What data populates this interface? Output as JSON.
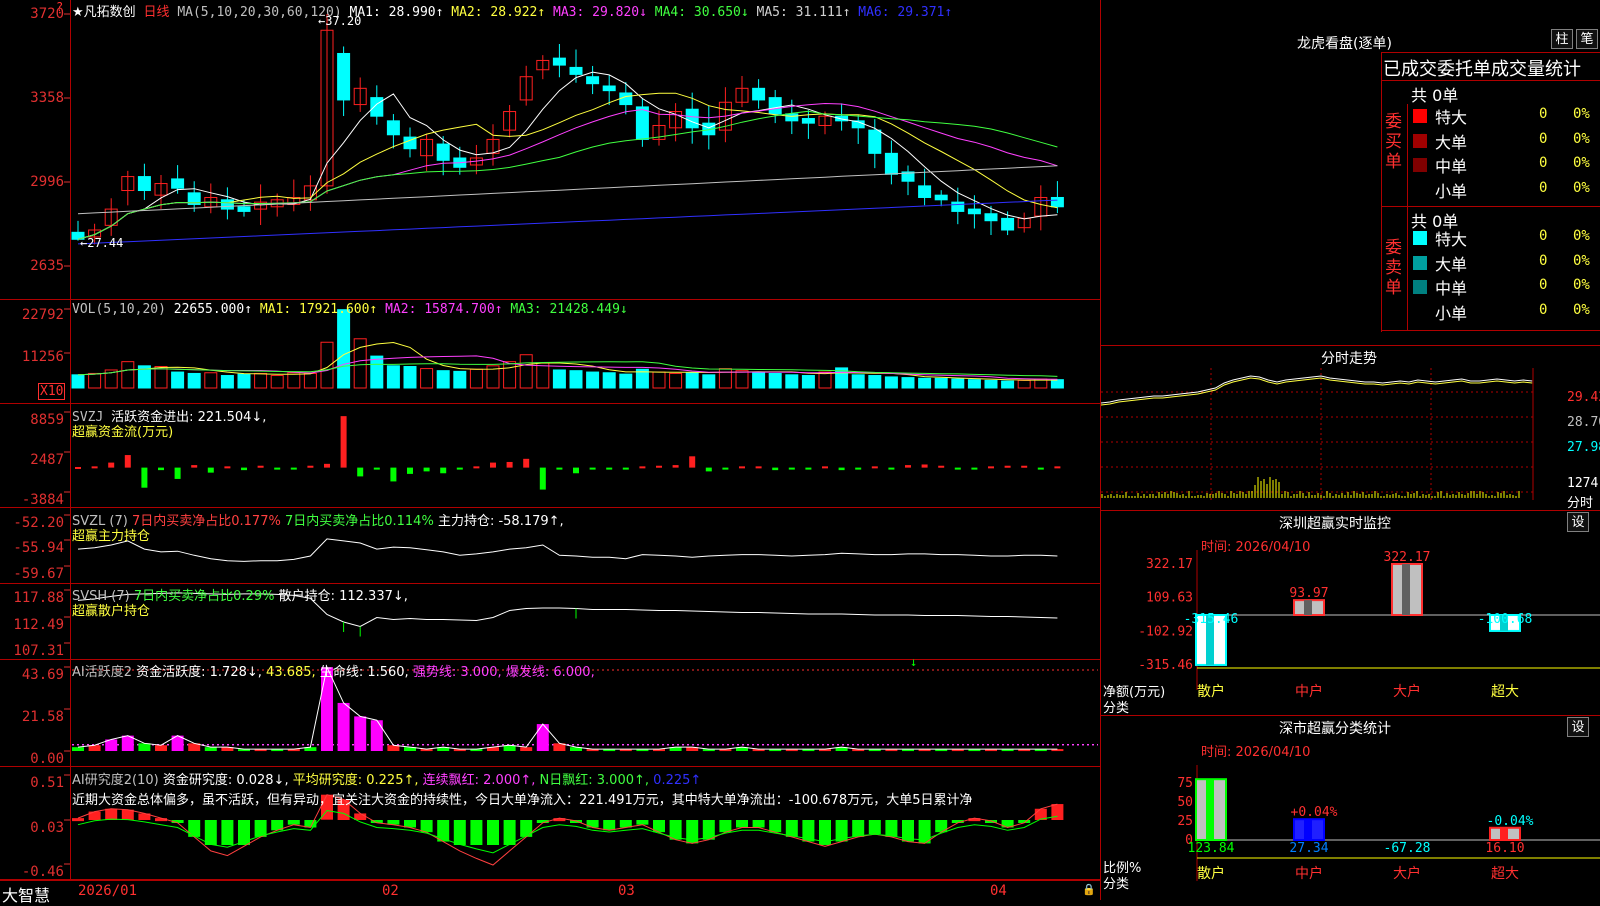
{
  "colors": {
    "up": "#ff2020",
    "down": "#00ffff",
    "ma1": "#ffffff",
    "ma2": "#ffff40",
    "ma3": "#ff40ff",
    "ma4": "#40ff40",
    "ma5": "#c0c0c0",
    "ma6": "#3030ff",
    "grid": "#b00000",
    "accent": "#ffff00"
  },
  "main": {
    "corner": "?",
    "title": "★凡拓数创",
    "period": "日线",
    "ma_label": "MA(5,10,20,30,60,120)",
    "ma1": "MA1: 28.990↑",
    "ma2": "MA2: 28.922↑",
    "ma3": "MA3: 29.820↓",
    "ma4": "MA4: 30.650↓",
    "ma5": "MA5: 31.111↑",
    "ma6": "MA6: 29.371↑",
    "high_mark": "37.20",
    "low_mark": "27.44",
    "y": [
      "3720",
      "3358",
      "2996",
      "2635"
    ]
  },
  "vol": {
    "label": "VOL(5,10,20)",
    "value": "22655.000↑",
    "ma1": "MA1: 17921.600↑",
    "ma2": "MA2: 15874.700↑",
    "ma3": "MA3: 21428.449↓",
    "y": [
      "22792",
      "11256"
    ],
    "unit": "X10"
  },
  "svzj": {
    "label": "SVZJ",
    "text": "活跃资金进出: 221.504↓,",
    "sub": "超赢资金流(万元)",
    "y": [
      "8859",
      "2487",
      "-3884"
    ]
  },
  "svzl": {
    "label": "SVZL (7)",
    "a": "7日内买卖净占比0.177%",
    "b": "7日内买卖净占比0.114%",
    "c": "主力持仓: -58.179↑,",
    "sub": "超赢主力持仓",
    "y": [
      "-52.20",
      "-55.94",
      "-59.67"
    ]
  },
  "svsh": {
    "label": "SVSH (7)",
    "a": "7日内买卖净占比0.29%",
    "c": "散户持仓: 112.337↓,",
    "sub": "超赢散户持仓",
    "y": [
      "117.88",
      "112.49",
      "107.31"
    ]
  },
  "ai1": {
    "label": "AI活跃度2",
    "a": "资金活跃度: 1.728↓,",
    "b": "43.685,",
    "c": "生命线: 1.560,",
    "d": "强势线: 3.000,",
    "e": "爆发线: 6.000,",
    "y": [
      "43.69",
      "21.58",
      "0.00"
    ]
  },
  "ai2": {
    "label": "AI研究度2(10)",
    "a": "资金研究度: 0.028↓,",
    "b": "平均研究度: 0.225↑,",
    "c": "连续飘红: 2.000↑,",
    "d": "N日飘红: 3.000↑,",
    "e": "0.225↑",
    "text": "近期大资金总体偏多，虽不活跃，但有异动，宜关注大资金的持续性，今日大单净流入：221.491万元，其中特大单净流出：-100.678万元，大单5日累计净",
    "y": [
      "0.51",
      "0.03",
      "-0.46"
    ]
  },
  "bottom": {
    "brand": "大智慧",
    "dates": [
      "2026/01",
      "02",
      "03",
      "04"
    ]
  },
  "lhb": {
    "title": "龙虎看盘(逐单)",
    "btn1": "柱",
    "btn2": "笔",
    "tabs": "已成交委托单成交量统计",
    "buy": {
      "side": "委买单",
      "total": "共 0单",
      "rows": [
        {
          "name": "特大",
          "v": "0",
          "p": "0%"
        },
        {
          "name": "大单",
          "v": "0",
          "p": "0%"
        },
        {
          "name": "中单",
          "v": "0",
          "p": "0%"
        },
        {
          "name": "小单",
          "v": "0",
          "p": "0%"
        }
      ]
    },
    "sell": {
      "side": "委卖单",
      "total": "共 0单",
      "rows": [
        {
          "name": "特大",
          "v": "0",
          "p": "0%"
        },
        {
          "name": "大单",
          "v": "0",
          "p": "0%"
        },
        {
          "name": "中单",
          "v": "0",
          "p": "0%"
        },
        {
          "name": "小单",
          "v": "0",
          "p": "0%"
        }
      ]
    }
  },
  "fenshi": {
    "title": "分时走势",
    "y": [
      "29.42",
      "28.70",
      "27.98",
      "1274",
      "分时"
    ]
  },
  "monitor": {
    "title": "深圳超赢实时监控",
    "btn": "设",
    "time": "时间: 2026/04/10",
    "y": [
      "322.17",
      "109.63",
      "-102.92",
      "-315.46"
    ],
    "bars": [
      {
        "cat": "散户",
        "val": -315.46,
        "label": "-315.46"
      },
      {
        "cat": "中户",
        "val": 93.97,
        "label": "93.97"
      },
      {
        "cat": "大户",
        "val": 322.17,
        "label": "322.17"
      },
      {
        "cat": "超大",
        "val": -100.68,
        "label": "-100.68"
      }
    ],
    "axis1": "净额(万元)",
    "axis2": "分类"
  },
  "classstat": {
    "title": "深市超赢分类统计",
    "btn": "设",
    "time": "时间: 2026/04/10",
    "y": [
      "75",
      "50",
      "25",
      "0"
    ],
    "bars": [
      {
        "cat": "散户",
        "val": 123.84,
        "pct": ""
      },
      {
        "cat": "中户",
        "val": 27.34,
        "pct": "+0.04%"
      },
      {
        "cat": "大户",
        "val": -67.28,
        "pct": ""
      },
      {
        "cat": "超大",
        "val": 16.1,
        "pct": "-0.04%"
      }
    ],
    "labels": [
      "123.84",
      "27.34",
      "-67.28",
      "16.10"
    ],
    "axis1": "比例%",
    "axis2": "分类"
  }
}
